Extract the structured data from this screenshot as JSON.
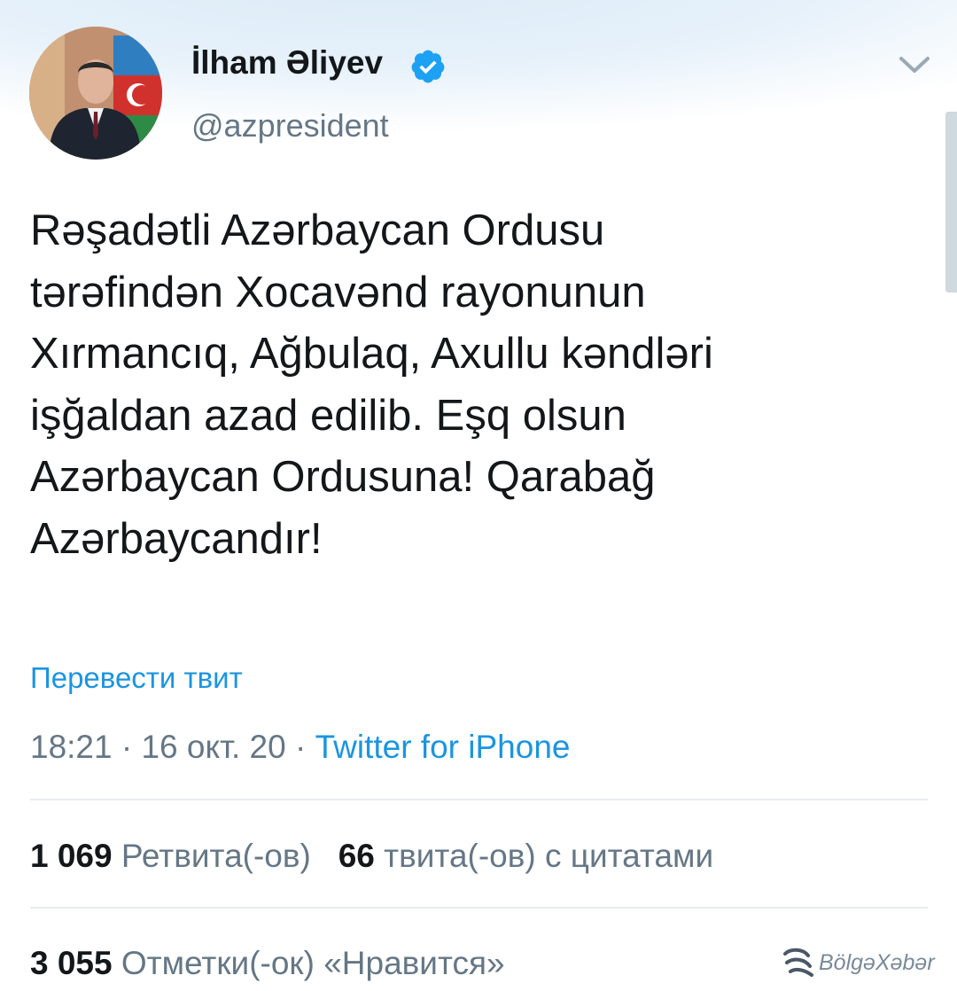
{
  "author": {
    "display_name": "İlham Əliyev",
    "handle": "@azpresident",
    "verified": true
  },
  "tweet": {
    "text_lines": [
      "Rəşadətli Azərbaycan Ordusu",
      "tərəfindən Xocavənd rayonunun",
      "Xırmancıq, Ağbulaq, Axullu kəndləri",
      "işğaldan azad edilib. Eşq olsun",
      "Azərbaycan Ordusuna! Qarabağ",
      "Azərbaycandır!"
    ],
    "translate_label": "Перевести твит",
    "time": "18:21",
    "date": "16 окт. 20",
    "source": "Twitter for iPhone"
  },
  "stats": {
    "retweets_count": "1 069",
    "retweets_label": "Ретвита(-ов)",
    "quotes_count": "66",
    "quotes_label": "твита(-ов) с цитатами",
    "likes_count": "3 055",
    "likes_label": "Отметки(-ок) «Нравится»"
  },
  "watermark": {
    "text": "BölgəXəbər"
  },
  "icons": {
    "verified": "verified-badge-icon",
    "menu": "chevron-down-icon"
  },
  "colors": {
    "link": "#1b95e0",
    "muted": "#657786",
    "verified": "#1da1f2",
    "text": "#14171a"
  }
}
